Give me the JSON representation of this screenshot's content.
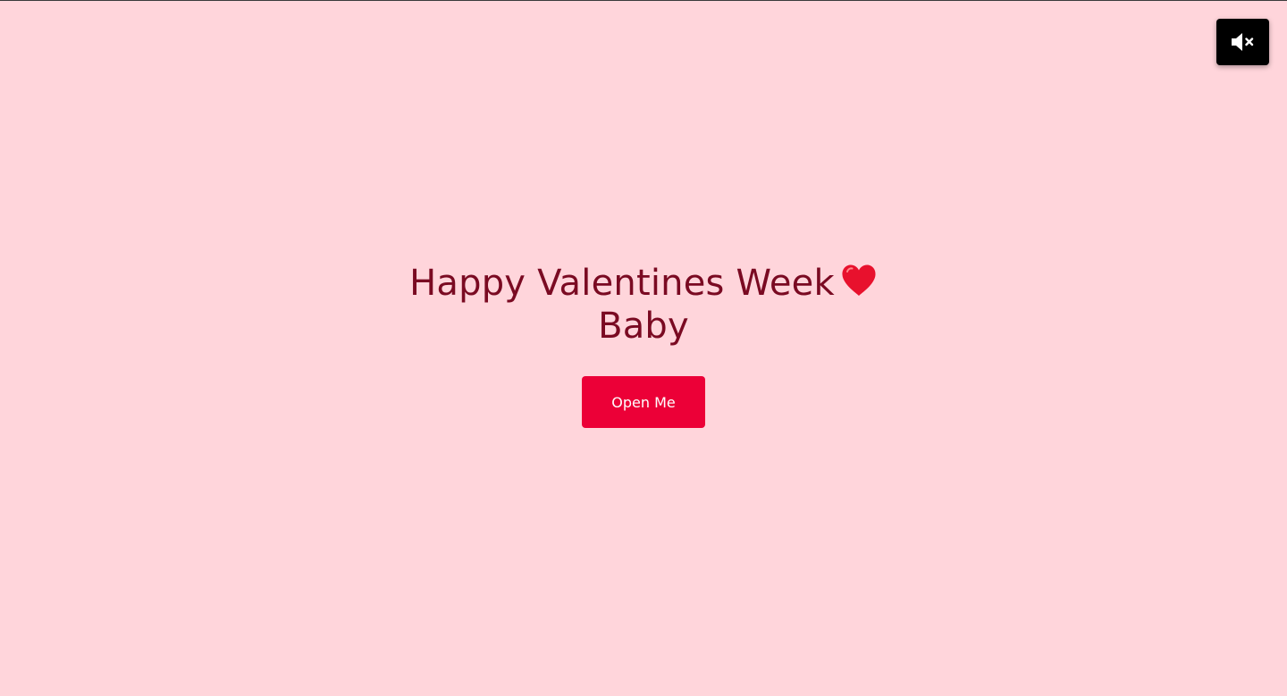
{
  "page": {
    "background_color": "#ffd5db",
    "text_color": "#7a0a22",
    "accent_color": "#ec0037"
  },
  "mute_button": {
    "icon": "speaker-muted-icon",
    "background_color": "#000000"
  },
  "greeting": {
    "line1": "Happy Valentines Week",
    "line2": "Baby",
    "emoji_icon": "red-heart-icon"
  },
  "open_button": {
    "label": "Open Me"
  }
}
